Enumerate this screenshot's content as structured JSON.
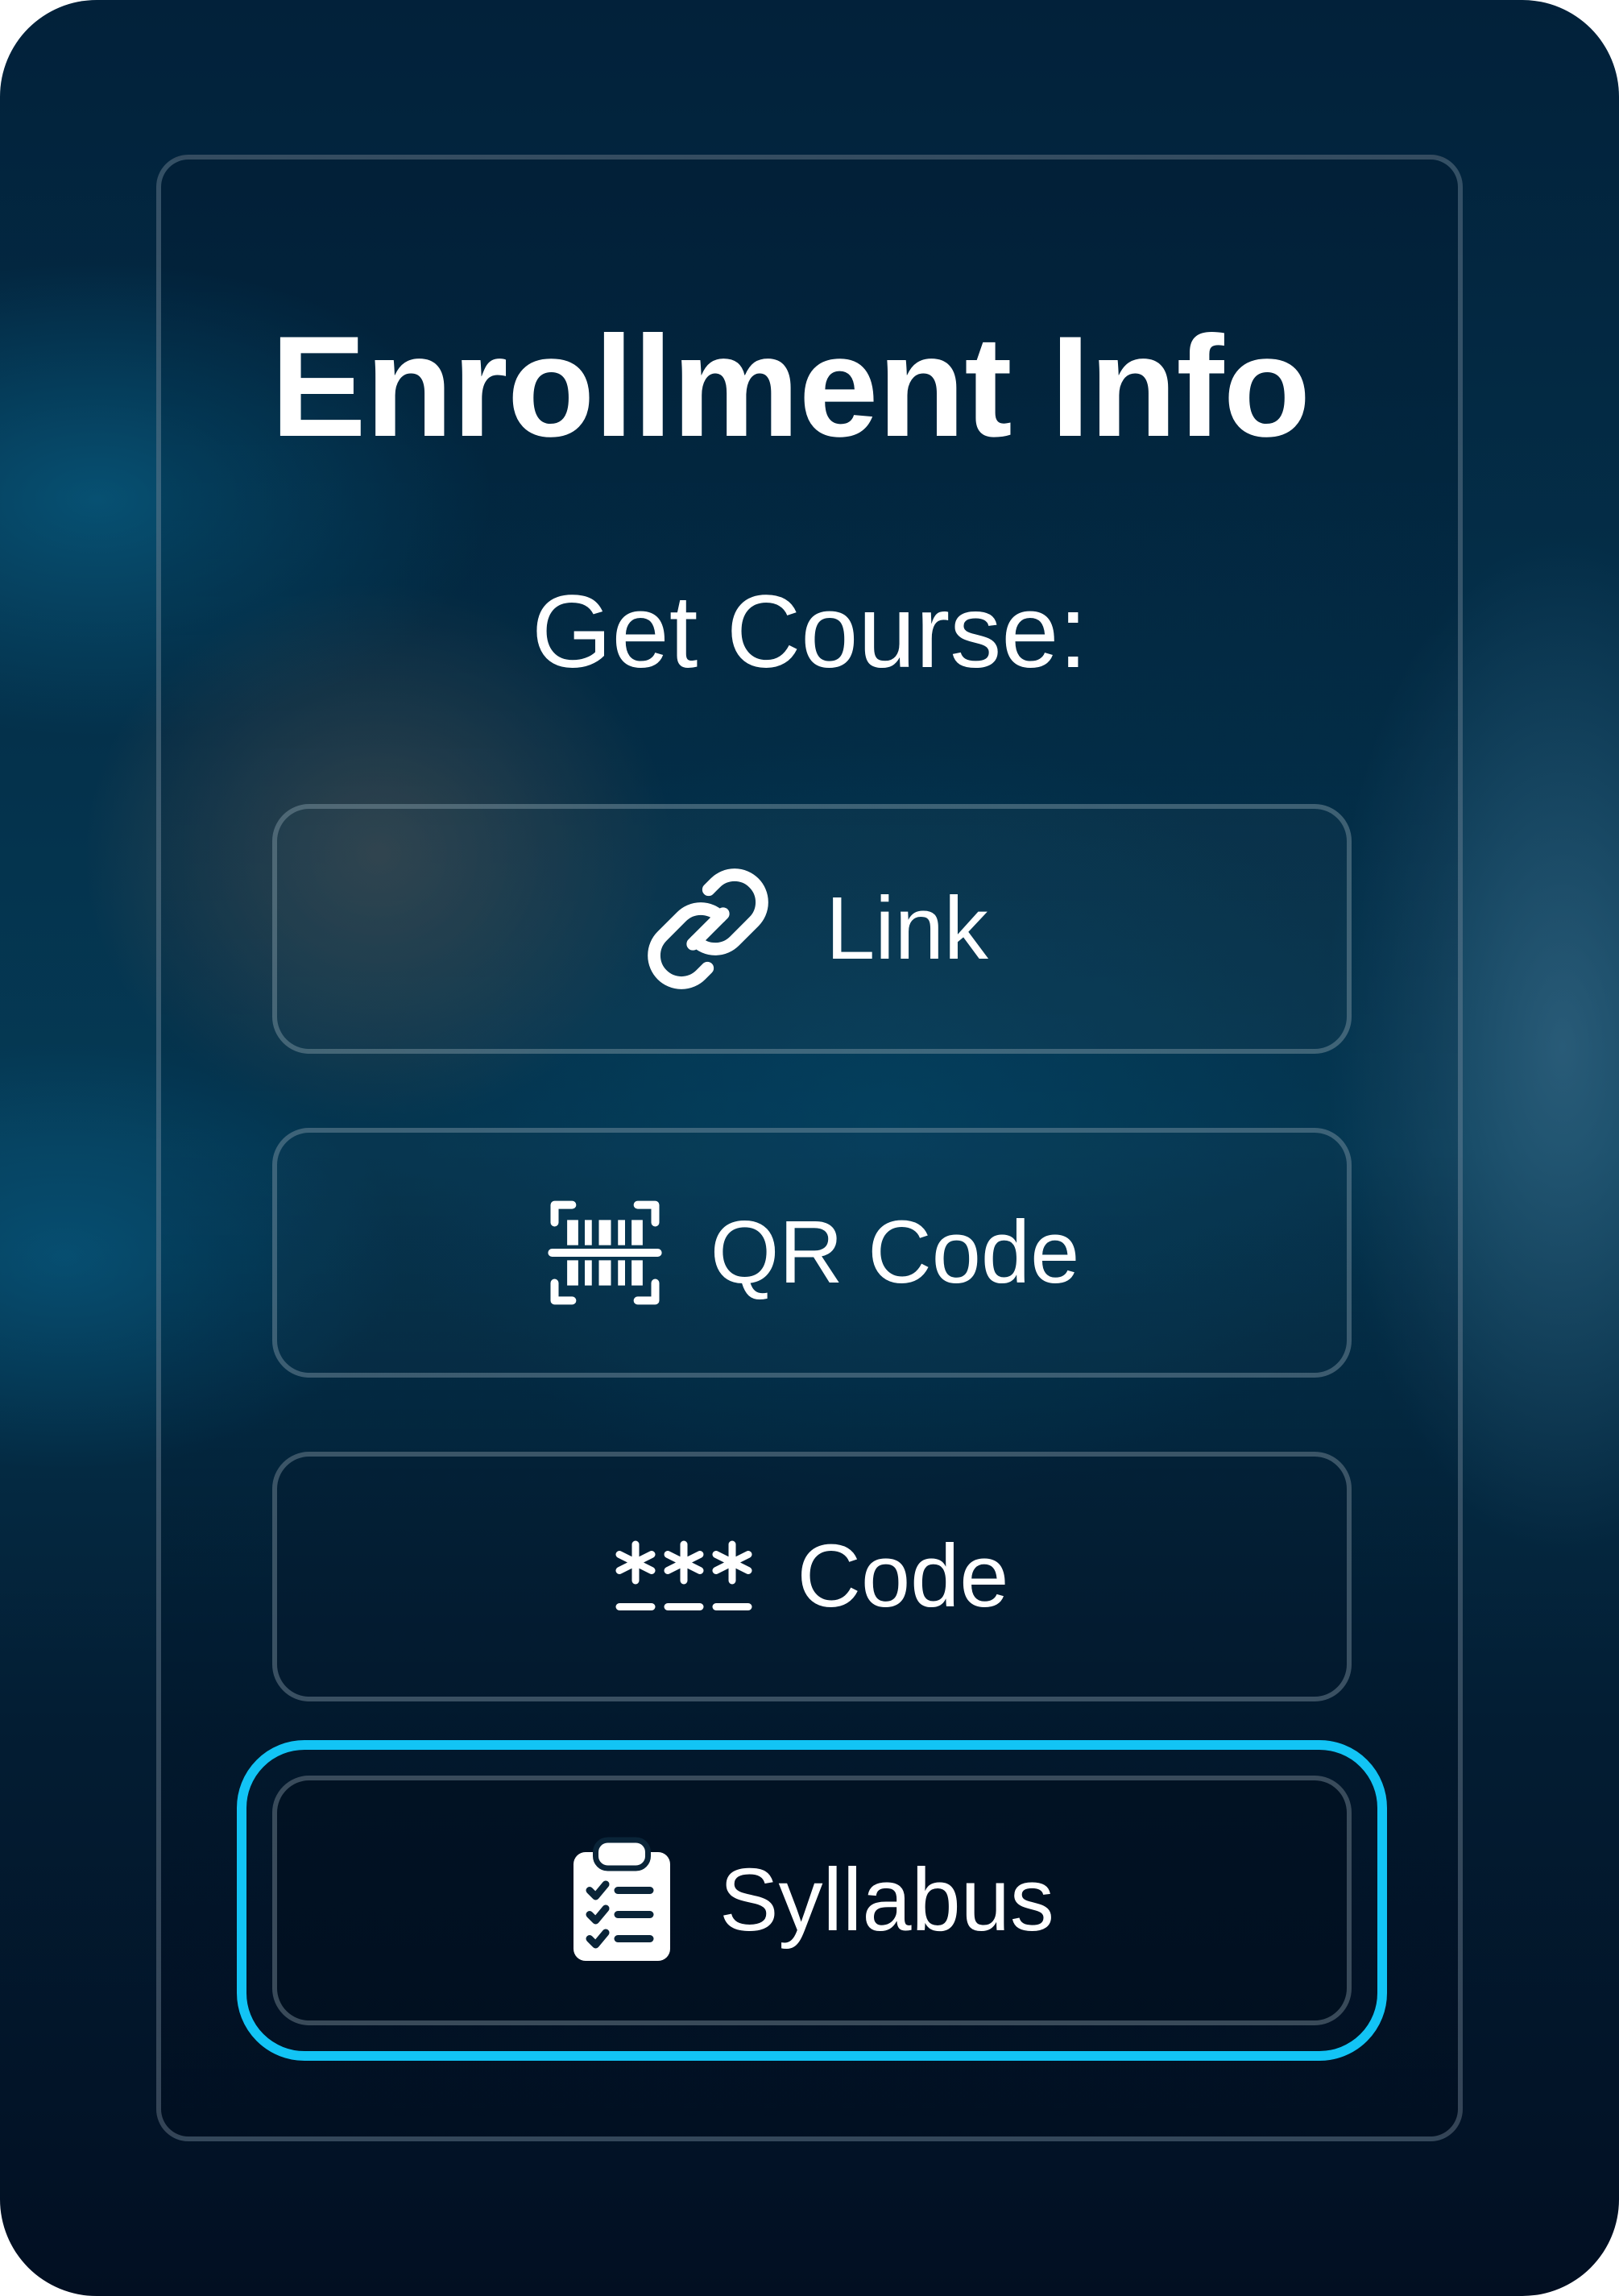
{
  "header": {
    "title": "Enrollment Info",
    "subtitle": "Get Course:"
  },
  "options": [
    {
      "label": "Link",
      "icon": "link-icon"
    },
    {
      "label": "QR Code",
      "icon": "qr-scan-icon"
    },
    {
      "label": "Code",
      "icon": "password-code-icon"
    },
    {
      "label": "Syllabus",
      "icon": "clipboard-checklist-icon",
      "focused": true
    }
  ],
  "colors": {
    "focus_ring": "#12c4f5",
    "text": "#ffffff",
    "background_top": "#02213a",
    "background_bottom": "#020f22"
  }
}
